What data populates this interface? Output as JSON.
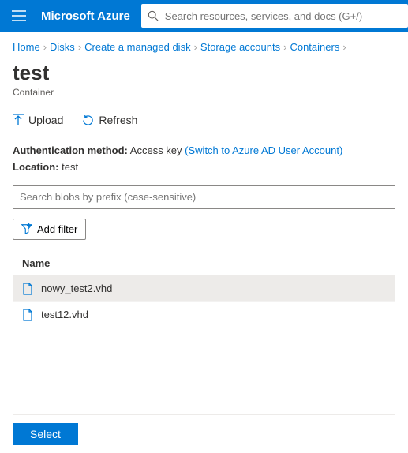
{
  "topbar": {
    "brand": "Microsoft Azure"
  },
  "search": {
    "placeholder": "Search resources, services, and docs (G+/)"
  },
  "breadcrumbs": [
    "Home",
    "Disks",
    "Create a managed disk",
    "Storage accounts",
    "Containers"
  ],
  "page": {
    "title": "test",
    "subtitle": "Container"
  },
  "toolbar": {
    "upload": "Upload",
    "refresh": "Refresh"
  },
  "meta": {
    "auth_label": "Authentication method:",
    "auth_value": "Access key",
    "auth_link": "(Switch to Azure AD User Account)",
    "loc_label": "Location:",
    "loc_value": "test"
  },
  "blobsearch": {
    "placeholder": "Search blobs by prefix (case-sensitive)"
  },
  "addfilter": "Add filter",
  "table": {
    "header_name": "Name",
    "rows": [
      {
        "name": "nowy_test2.vhd",
        "selected": true
      },
      {
        "name": "test12.vhd",
        "selected": false
      }
    ]
  },
  "footer": {
    "select": "Select"
  }
}
